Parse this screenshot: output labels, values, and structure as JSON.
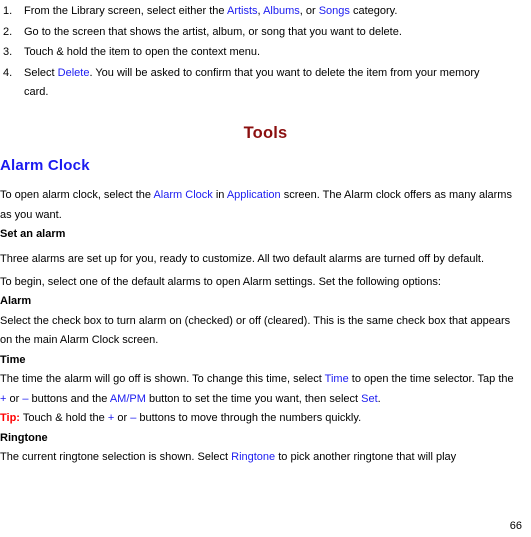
{
  "colors": {
    "title": "#8b0f0f",
    "heading": "#1b1bf0",
    "link": "#1b1bf0",
    "tip": "#ff0000",
    "text": "#000000",
    "background": "#ffffff"
  },
  "list": {
    "items": [
      {
        "number": "1.",
        "segments": [
          {
            "text": "From the Library screen, select either the ",
            "style": "plain"
          },
          {
            "text": "Artists",
            "style": "link"
          },
          {
            "text": ", ",
            "style": "plain"
          },
          {
            "text": "Albums",
            "style": "link"
          },
          {
            "text": ", or ",
            "style": "plain"
          },
          {
            "text": "Songs",
            "style": "link"
          },
          {
            "text": " category.",
            "style": "plain"
          }
        ],
        "plain": "From the Library screen, select either the Artists, Albums, or Songs category."
      },
      {
        "number": "2.",
        "segments": [
          {
            "text": "Go to the screen that shows the artist, album, or song that you want to delete.",
            "style": "plain"
          }
        ],
        "plain": "Go to the screen that shows the artist, album, or song that you want to delete."
      },
      {
        "number": "3.",
        "segments": [
          {
            "text": "Touch & hold the item to open the context menu.",
            "style": "plain"
          }
        ],
        "plain": "Touch & hold the item to open the context menu."
      },
      {
        "number": "4.",
        "segments": [
          {
            "text": "Select ",
            "style": "plain"
          },
          {
            "text": "Delete",
            "style": "link"
          },
          {
            "text": ". You will be asked to confirm that you want to delete the item from your memory card.",
            "style": "plain"
          }
        ],
        "plain": "Select Delete. You will be asked to confirm that you want to delete the item from your memory card."
      }
    ]
  },
  "title": "Tools",
  "section": {
    "heading": "Alarm Clock",
    "intro": {
      "segments": [
        {
          "text": "To open alarm clock, select the ",
          "style": "plain"
        },
        {
          "text": "Alarm Clock",
          "style": "link"
        },
        {
          "text": " in ",
          "style": "plain"
        },
        {
          "text": "Application",
          "style": "link"
        },
        {
          "text": " screen. The Alarm clock offers as many alarms as you want.",
          "style": "plain"
        }
      ],
      "plain": "To open alarm clock, select the Alarm Clock in Application screen. The Alarm clock offers as many alarms as you want."
    },
    "set_an_alarm": {
      "heading": "Set an alarm",
      "paragraph1": "Three alarms are set up for you, ready to customize. All two default alarms are turned off by default.",
      "paragraph2": "To begin, select one of the default alarms to open Alarm settings. Set the following options:"
    },
    "options": [
      {
        "heading": "Alarm",
        "segments": [
          {
            "text": "Select the check box to turn alarm on (checked) or off (cleared). This is the same check box that appears on the main Alarm Clock screen.",
            "style": "plain"
          }
        ],
        "plain": "Select the check box to turn alarm on (checked) or off (cleared). This is the same check box that appears on the main Alarm Clock screen."
      },
      {
        "heading": "Time",
        "segments": [
          {
            "text": "The time the alarm will go off is shown. To change this time, select ",
            "style": "plain"
          },
          {
            "text": "Time",
            "style": "link"
          },
          {
            "text": " to open the time selector. Tap the ",
            "style": "plain"
          },
          {
            "text": "+",
            "style": "link"
          },
          {
            "text": " or ",
            "style": "plain"
          },
          {
            "text": "–",
            "style": "link"
          },
          {
            "text": " buttons and the ",
            "style": "plain"
          },
          {
            "text": "AM/PM",
            "style": "link"
          },
          {
            "text": " button to set the time you want, then select ",
            "style": "plain"
          },
          {
            "text": "Set",
            "style": "link"
          },
          {
            "text": ".",
            "style": "plain"
          }
        ],
        "plain": "The time the alarm will go off is shown. To change this time, select Time to open the time selector. Tap the + or – buttons and the AM/PM button to set the time you want, then select Set."
      }
    ],
    "tip": {
      "label": "Tip:",
      "segments": [
        {
          "text": " Touch & hold the ",
          "style": "plain"
        },
        {
          "text": "+",
          "style": "link"
        },
        {
          "text": " or ",
          "style": "plain"
        },
        {
          "text": "–",
          "style": "link"
        },
        {
          "text": " buttons to move through the numbers quickly.",
          "style": "plain"
        }
      ],
      "plain": "Tip: Touch & hold the + or – buttons to move through the numbers quickly."
    },
    "ringtone": {
      "heading": "Ringtone",
      "segments": [
        {
          "text": "The current ringtone selection is shown. Select ",
          "style": "plain"
        },
        {
          "text": "Ringtone",
          "style": "link"
        },
        {
          "text": " to pick another ringtone that will play",
          "style": "plain"
        }
      ],
      "plain": "The current ringtone selection is shown. Select Ringtone to pick another ringtone that will play"
    }
  },
  "page_number": "66"
}
